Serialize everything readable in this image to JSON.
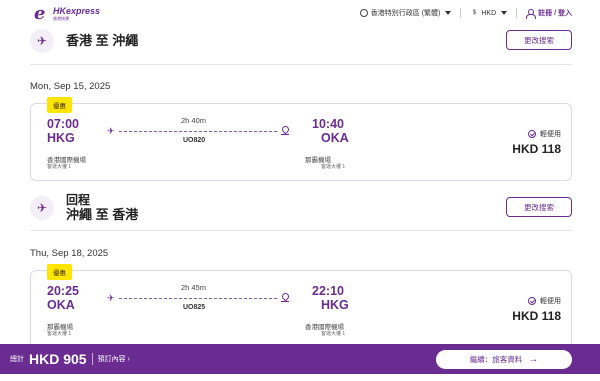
{
  "header": {
    "logo_brand": "HKexpress",
    "logo_sub": "香港快運",
    "region": "香港特別行政區 (繁體)",
    "currency": "HKD",
    "login": "註冊 / 登入"
  },
  "outbound": {
    "title": "香港 至 沖繩",
    "change_label": "更改搜索",
    "date": "Mon, Sep 15, 2025",
    "card": {
      "tag": "優惠",
      "dep_time": "07:00",
      "dep_code": "HKG",
      "dep_airport": "香港國際機場",
      "dep_terminal": "客運大樓 1",
      "duration": "2h 40m",
      "flight_no": "UO820",
      "arr_time": "10:40",
      "arr_code": "OKA",
      "arr_airport": "那霸機場",
      "arr_terminal": "客運大樓 1",
      "fare_type": "輕便用",
      "price": "HKD 118"
    }
  },
  "return": {
    "kind": "回程",
    "title": "沖繩 至 香港",
    "change_label": "更改搜索",
    "date": "Thu, Sep 18, 2025",
    "card": {
      "tag": "優惠",
      "dep_time": "20:25",
      "dep_code": "OKA",
      "dep_airport": "那霸機場",
      "dep_terminal": "客運大樓 1",
      "duration": "2h 45m",
      "flight_no": "UO825",
      "arr_time": "22:10",
      "arr_code": "HKG",
      "arr_airport": "香港國際機場",
      "arr_terminal": "客運大樓 1",
      "fare_type": "輕便用",
      "price": "HKD 118"
    }
  },
  "bottom": {
    "total_label": "總計",
    "total_amount": "HKD 905",
    "details": "預訂內容 ›",
    "continue": "繼續：旅客資料"
  },
  "colors": {
    "brand": "#6b2c91",
    "tag": "#ffe500"
  }
}
